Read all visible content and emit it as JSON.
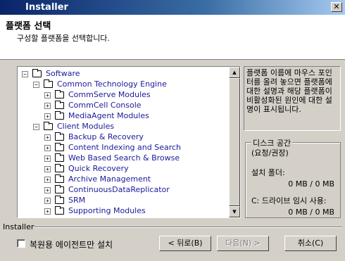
{
  "window": {
    "title": "Installer",
    "close_glyph": "✕"
  },
  "header": {
    "title": "플랫폼 선택",
    "subtitle": "구성할 플랫폼을 선택합니다."
  },
  "tree": {
    "items": [
      {
        "label": "Software",
        "expander": "−"
      },
      {
        "label": "Common Technology Engine",
        "expander": "−"
      },
      {
        "label": "CommServe Modules",
        "expander": "+"
      },
      {
        "label": "CommCell Console",
        "expander": "+"
      },
      {
        "label": "MediaAgent Modules",
        "expander": "+"
      },
      {
        "label": "Client Modules",
        "expander": "−"
      },
      {
        "label": "Backup & Recovery",
        "expander": "+"
      },
      {
        "label": "Content Indexing and Search",
        "expander": "+"
      },
      {
        "label": "Web Based Search & Browse",
        "expander": "+"
      },
      {
        "label": "Quick Recovery",
        "expander": "+"
      },
      {
        "label": "Archive Management",
        "expander": "+"
      },
      {
        "label": "ContinuousDataReplicator",
        "expander": "+"
      },
      {
        "label": "SRM",
        "expander": "+"
      },
      {
        "label": "Supporting Modules",
        "expander": "+"
      }
    ],
    "scroll_up": "▲",
    "scroll_down": "▼"
  },
  "info_text": "플랫폼 이름에 마우스 포인터를 올려 놓으면 플랫폼에 대한 설명과 해당 플랫폼이 비활성화된 원인에 대한 설명이 표시됩니다.",
  "disk": {
    "title": "디스크 공간",
    "ratio_label": "(요청/권장)",
    "install_folder_label": "설치 폴더:",
    "install_folder_value": "0 MB / 0 MB",
    "temp_label": "C: 드라이브 임시 사용:",
    "temp_value": "0 MB / 0 MB"
  },
  "footer": {
    "label": "Installer",
    "checkbox_label": "복원용 에이전트만 설치",
    "back_button": "< 뒤로(B)",
    "next_button": "다음(N) >",
    "cancel_button": "취소(C)"
  }
}
